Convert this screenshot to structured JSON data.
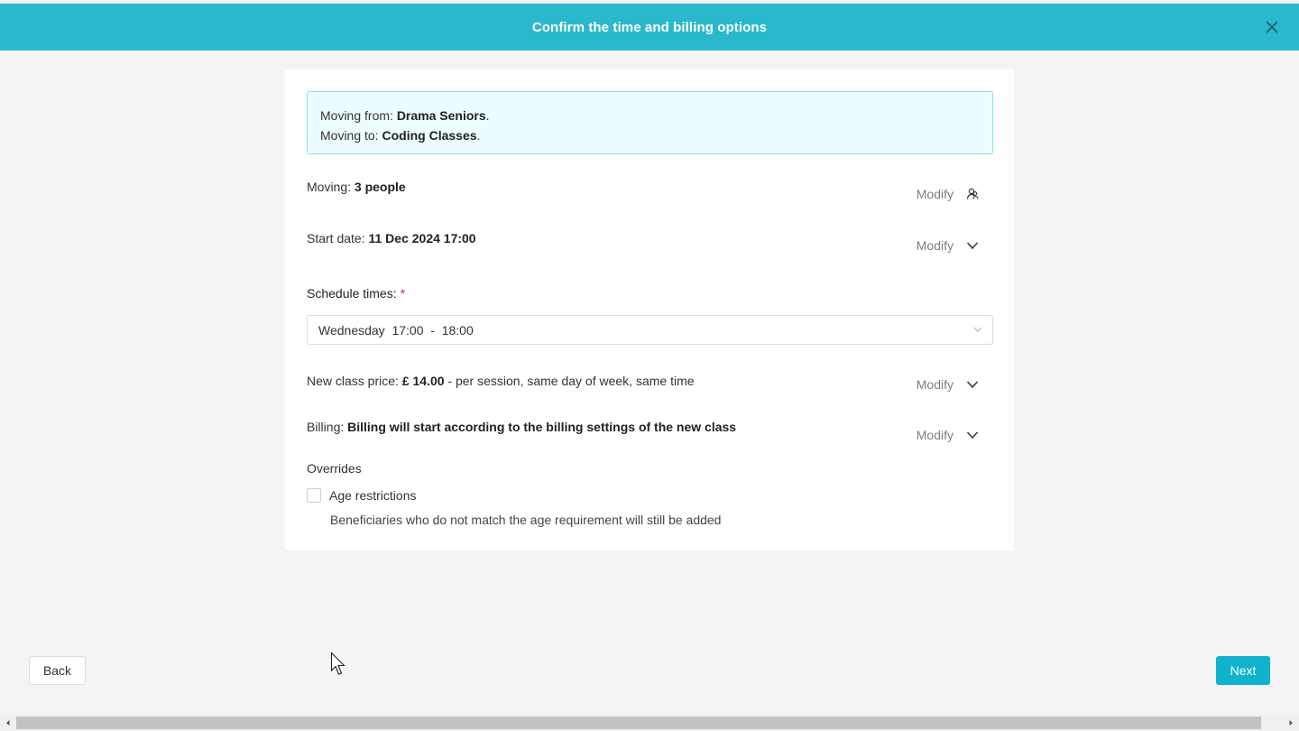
{
  "header": {
    "title": "Confirm the time and billing options",
    "close_icon": "close-icon"
  },
  "move_info": {
    "from_label": "Moving from: ",
    "from_value": "Drama Seniors",
    "to_label": "Moving to: ",
    "to_value": "Coding Classes",
    "period": "."
  },
  "moving": {
    "label": "Moving: ",
    "value": "3 people",
    "modify": "Modify",
    "icon": "people-icon"
  },
  "start_date": {
    "label": "Start date: ",
    "value": "11 Dec 2024 17:00",
    "modify": "Modify",
    "icon": "chevron-down-icon"
  },
  "schedule": {
    "label": "Schedule times:",
    "required_mark": "*",
    "selected": "Wednesday  17:00  -  18:00"
  },
  "price": {
    "label": "New class price: ",
    "value": "£ 14.00",
    "suffix": " - per session, same day of week, same time",
    "modify": "Modify"
  },
  "billing": {
    "label": "Billing: ",
    "value": "Billing will start according to the billing settings of the new class",
    "modify": "Modify"
  },
  "overrides": {
    "title": "Overrides",
    "age_label": "Age restrictions",
    "age_checked": false,
    "age_desc": "Beneficiaries who do not match the age requirement will still be added"
  },
  "footer": {
    "back_label": "Back",
    "next_label": "Next"
  },
  "colors": {
    "header": "#2ab8cc",
    "next_button": "#0fb3ce",
    "info_bg": "#ebfdfe",
    "info_border": "#8ee1ea",
    "required": "#e0245e"
  }
}
